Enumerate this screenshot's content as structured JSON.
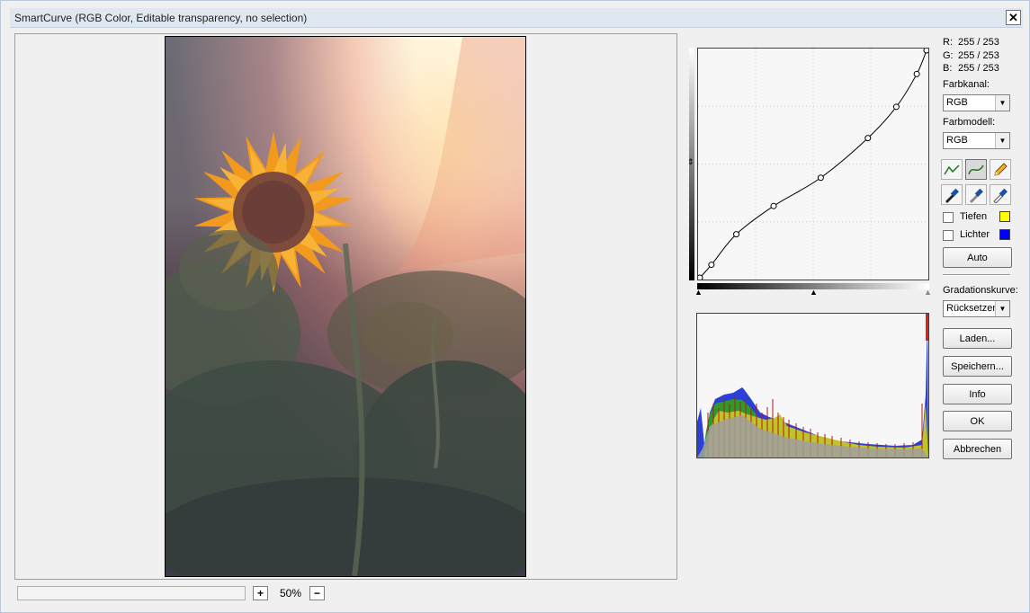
{
  "window": {
    "title": "SmartCurve (RGB Color, Editable transparency, no selection)",
    "close_glyph": "✕"
  },
  "preview": {
    "zoom_in_label": "+",
    "zoom_out_label": "−",
    "zoom_value": "50%",
    "progress": 0
  },
  "readout": {
    "r_label": "R:",
    "r_value": "255 / 253",
    "g_label": "G:",
    "g_value": "255 / 253",
    "b_label": "B:",
    "b_value": "255 / 253"
  },
  "controls": {
    "channel_label": "Farbkanal:",
    "channel_value": "RGB",
    "model_label": "Farbmodell:",
    "model_value": "RGB",
    "shadows_label": "Tiefen",
    "shadows_checked": false,
    "shadows_color": "#ffff00",
    "highlights_label": "Lichter",
    "highlights_checked": false,
    "highlights_color": "#0000ff",
    "auto_label": "Auto",
    "curve_label": "Gradationskurve:",
    "curve_value": "Rücksetzen",
    "load_label": "Laden...",
    "save_label": "Speichern...",
    "info_label": "Info",
    "ok_label": "OK",
    "cancel_label": "Abbrechen"
  },
  "tools": [
    {
      "name": "polyline-curve-icon",
      "active": false
    },
    {
      "name": "smooth-curve-icon",
      "active": true
    },
    {
      "name": "pencil-icon",
      "active": false
    },
    {
      "name": "black-eyedropper-icon",
      "active": false
    },
    {
      "name": "gray-eyedropper-icon",
      "active": false
    },
    {
      "name": "white-eyedropper-icon",
      "active": false
    }
  ],
  "curve": {
    "points": [
      [
        0,
        0
      ],
      [
        13,
        17
      ],
      [
        41,
        57
      ],
      [
        83,
        94
      ],
      [
        136,
        131
      ],
      [
        189,
        183
      ],
      [
        221,
        224
      ],
      [
        244,
        267
      ],
      [
        255,
        298
      ]
    ]
  }
}
